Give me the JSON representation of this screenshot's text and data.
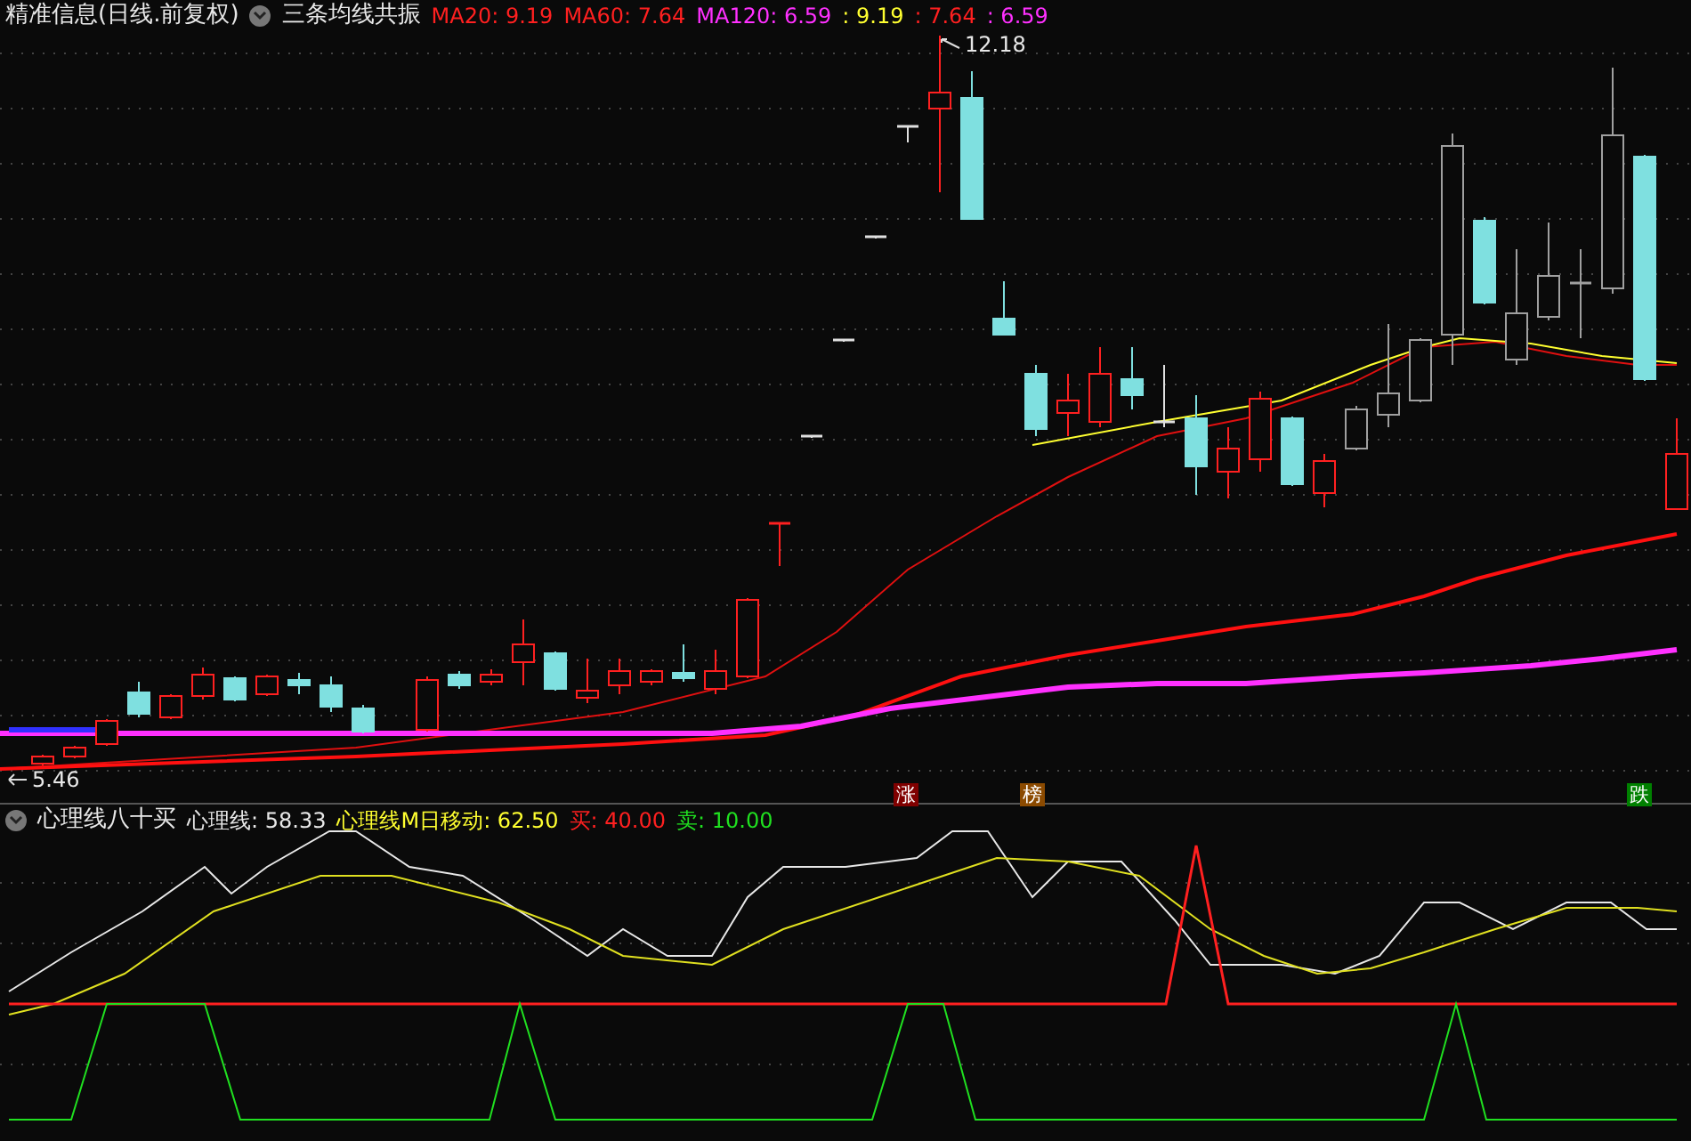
{
  "price_panel": {
    "title": "精准信息(日线.前复权)",
    "indicator": "三条均线共振",
    "readings": [
      {
        "text": "MA20: 9.19",
        "color": "#ff2020"
      },
      {
        "text": "MA60: 7.64",
        "color": "#ff2020"
      },
      {
        "text": "MA120: 6.59",
        "color": "#ff30ff"
      },
      {
        "text": ": 9.19",
        "color": "#ffff30"
      },
      {
        "text": ": 7.64",
        "color": "#ff2020"
      },
      {
        "text": ": 6.59",
        "color": "#ff30ff"
      }
    ],
    "high_label": "12.18",
    "low_label": "5.46",
    "markers": [
      {
        "text": "涨",
        "color": "#800000"
      },
      {
        "text": "榜",
        "color": "#8b4a00"
      },
      {
        "text": "跌",
        "color": "#008000"
      }
    ]
  },
  "indicator_panel": {
    "title": "心理线八十买",
    "readings": [
      {
        "text": "心理线: 58.33",
        "color": "#e8e8e8"
      },
      {
        "text": "心理线M日移动: 62.50",
        "color": "#ffff30"
      },
      {
        "text": "买: 40.00",
        "color": "#ff2020"
      },
      {
        "text": "卖: 10.00",
        "color": "#20e020"
      }
    ]
  }
}
